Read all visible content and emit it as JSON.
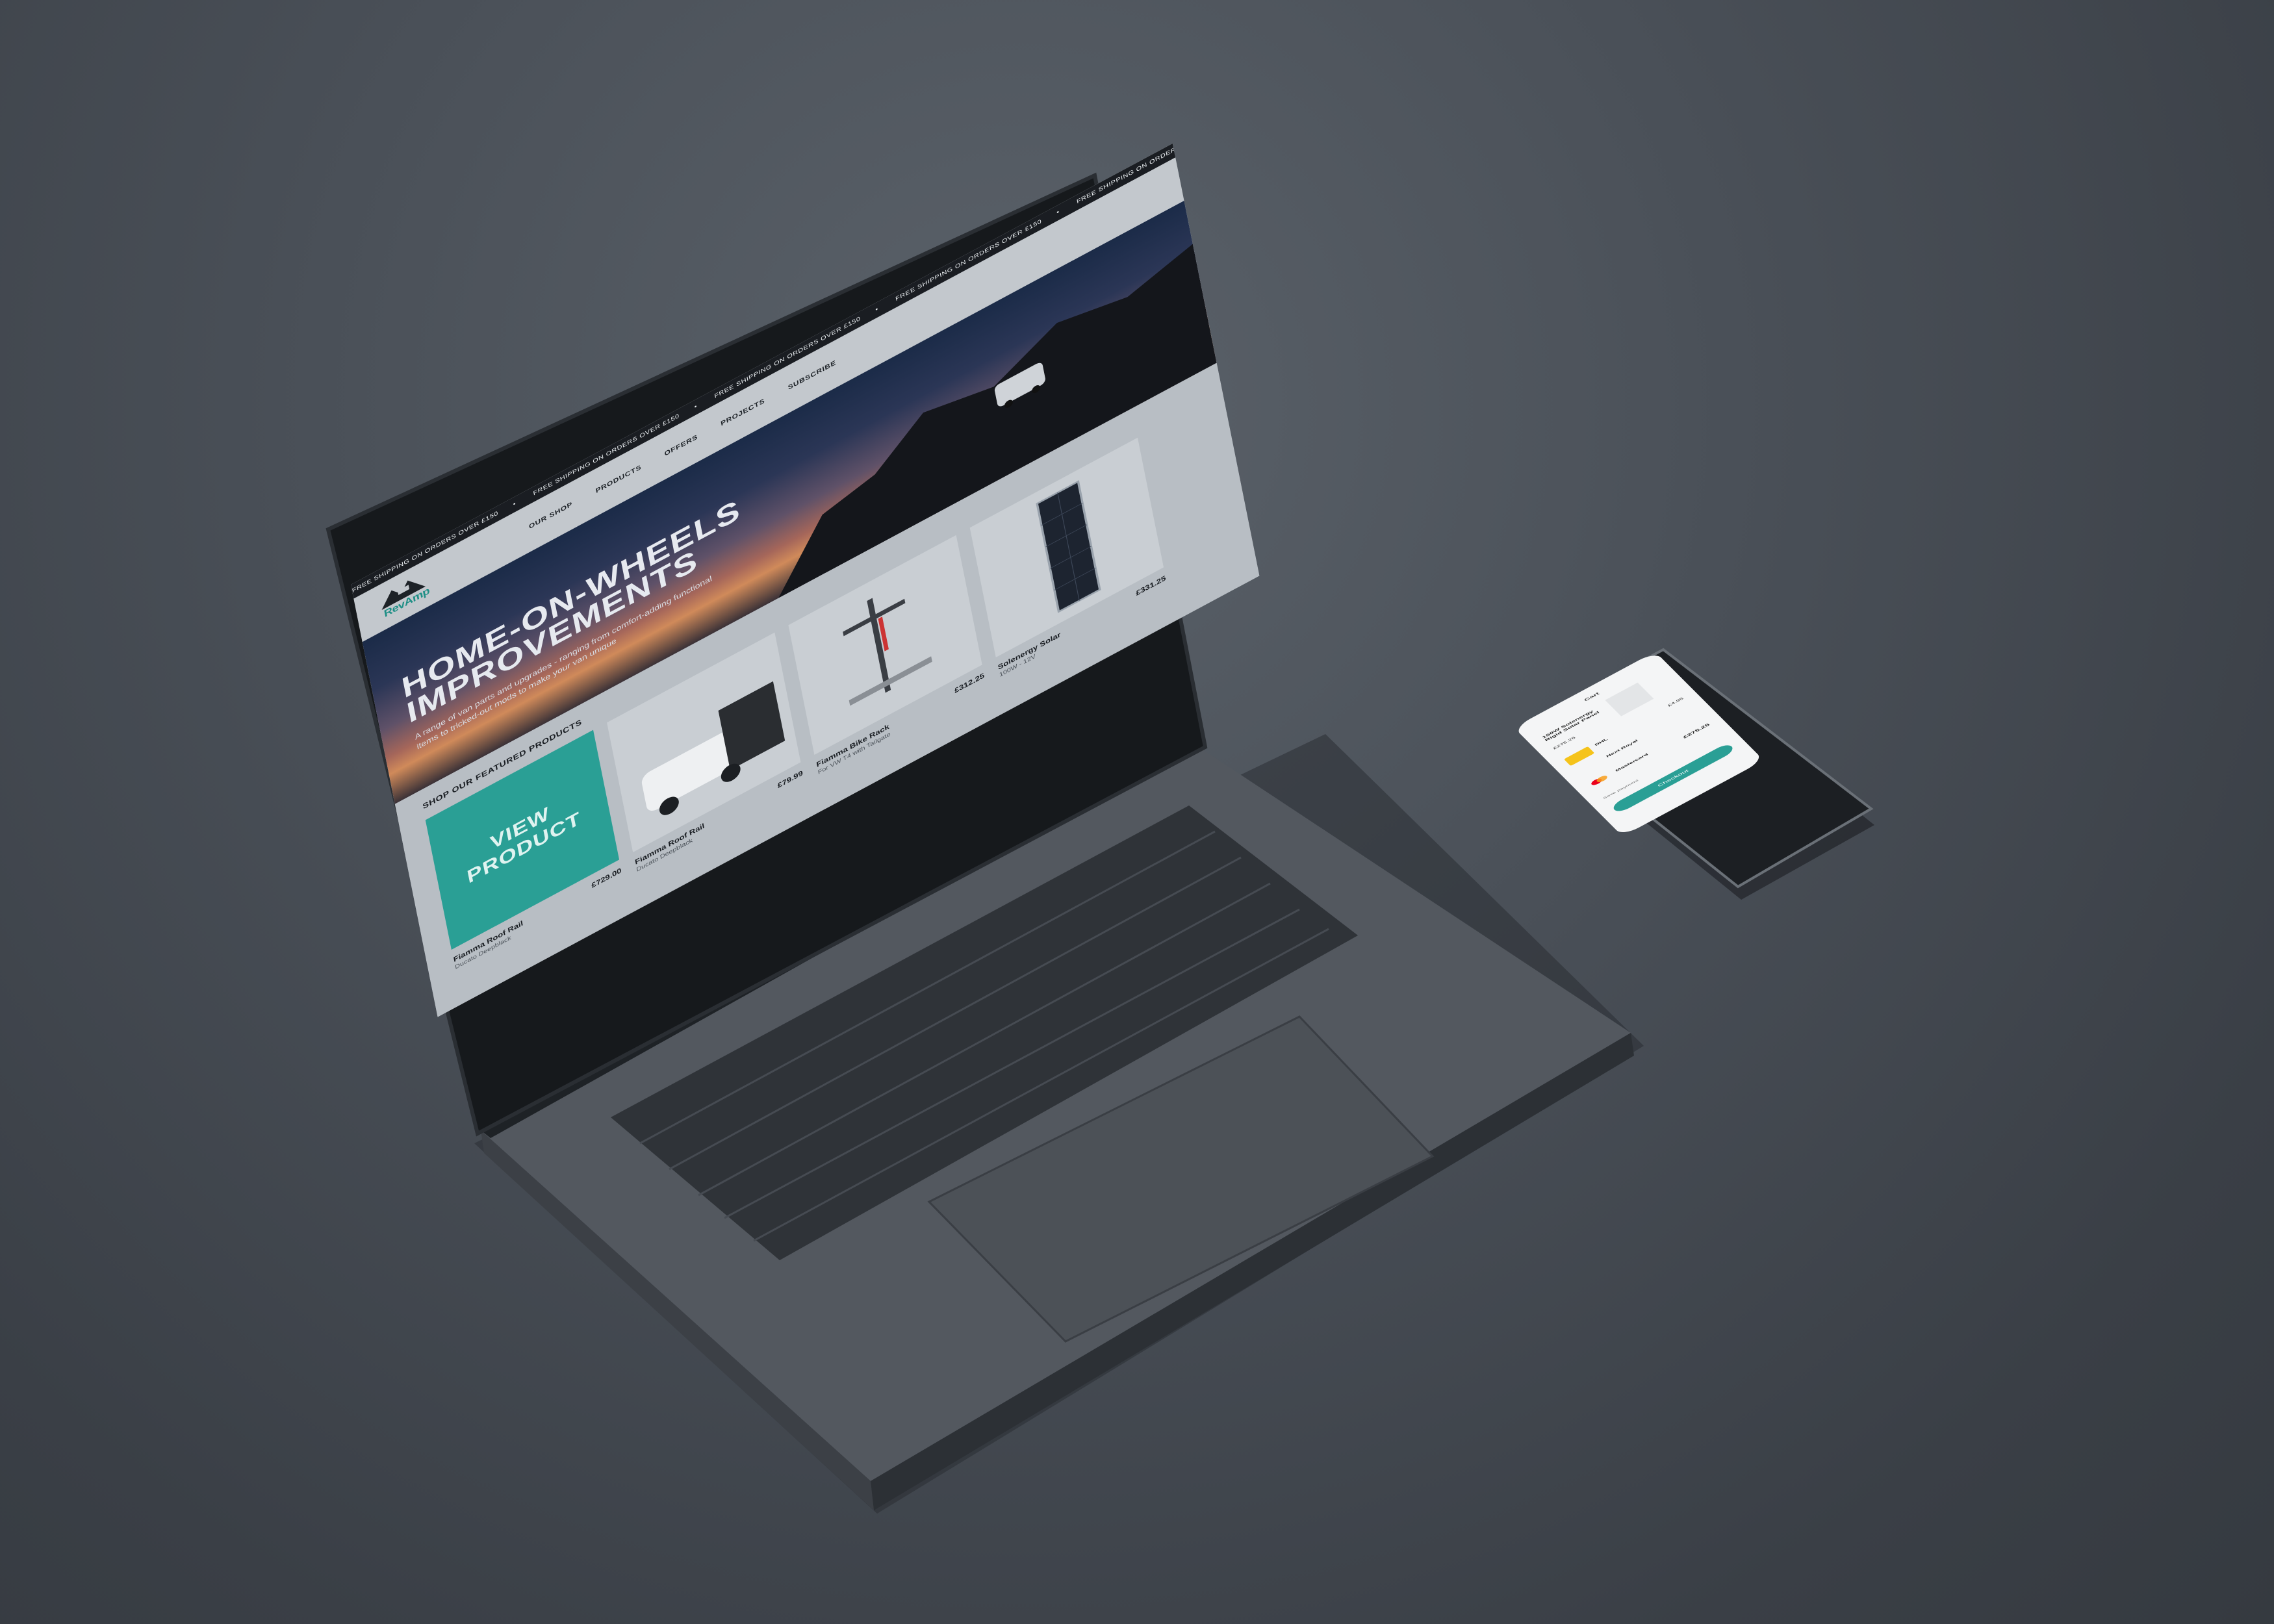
{
  "ticker": {
    "items": [
      "FREE SHIPPING ON ORDERS OVER £150",
      "FREE SHIPPING ON ORDERS OVER £150",
      "FREE SHIPPING ON ORDERS OVER £150",
      "FREE SHIPPING ON ORDERS OVER £150",
      "FREE SHIPPING ON ORDERS OVER £150"
    ]
  },
  "brand": {
    "logo_text": "RevAmp"
  },
  "nav": {
    "items": [
      "OUR SHOP",
      "PRODUCTS",
      "OFFERS",
      "PROJECTS",
      "SUBSCRIBE"
    ]
  },
  "hero": {
    "title_line1": "HOME-ON-WHEELS",
    "title_line2": "IMPROVEMENTS",
    "subtitle": "A range of van parts and upgrades - ranging from comfort-adding functional items to tricked-out mods to make your van unique"
  },
  "featured": {
    "title": "SHOP OUR FEATURED PRODUCTS",
    "products": [
      {
        "name": "Fiamma Roof Rail",
        "sub": "Ducato Deepblack",
        "price": "£729.00",
        "overlay": "VIEW PRODUCT"
      },
      {
        "name": "Fiamma Roof Rail",
        "sub": "Ducato Deepblack",
        "price": "£79.99"
      },
      {
        "name": "Fiamma Bike Rack",
        "sub": "For VW T4 with Tailgate",
        "price": "£312.25"
      },
      {
        "name": "Solenergy Solar",
        "sub": "100W - 12V",
        "price": "£331.25"
      }
    ]
  },
  "phone": {
    "header": "Cart",
    "item_name": "150W Solenergy Rigid Solar Panel",
    "item_price": "£275.25",
    "shipping_option": "DHL",
    "shipping_price": "£4.95",
    "shipping_option_2": "Next Royal",
    "payment": "Mastercard",
    "total": "£275.25",
    "save_label": "Save payment",
    "button": "Checkout"
  },
  "colors": {
    "accent": "#2a9f95",
    "background": "#4a5058"
  }
}
